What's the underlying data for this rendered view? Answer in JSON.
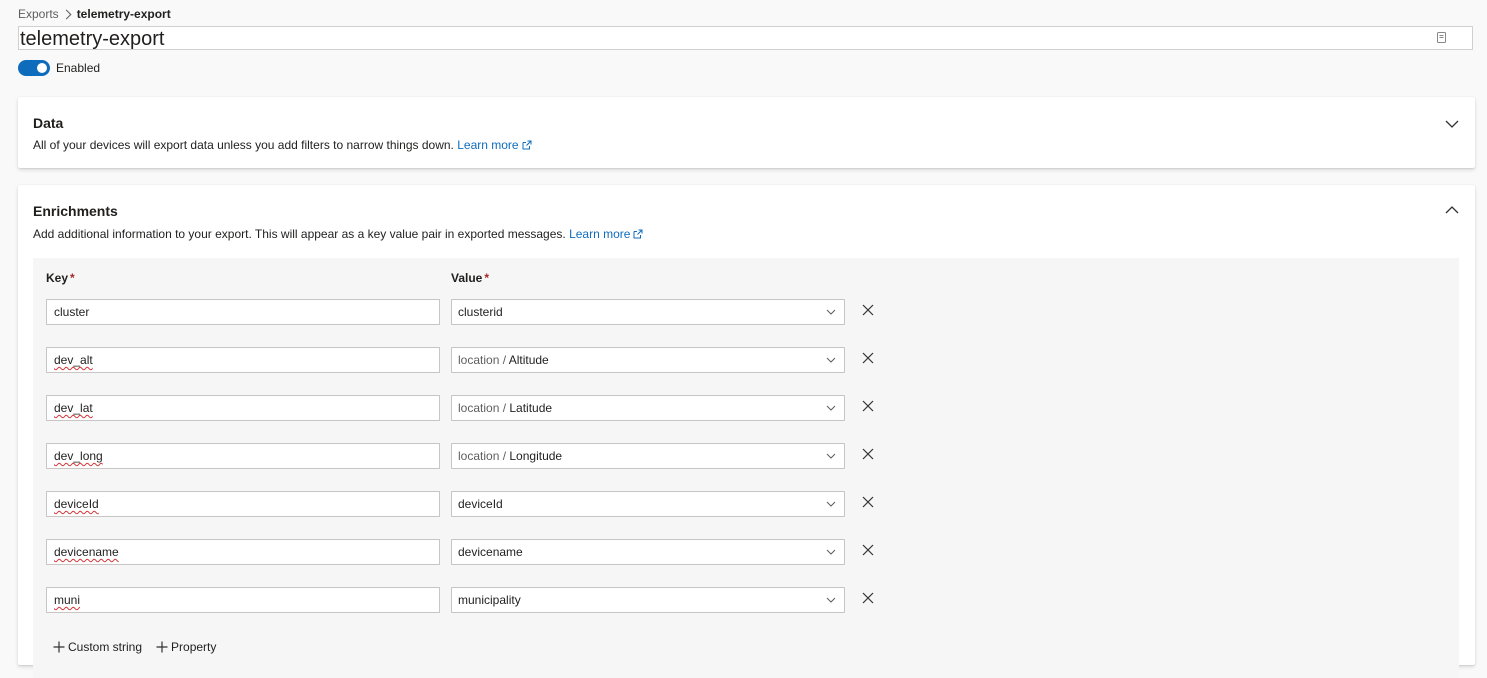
{
  "breadcrumb": {
    "parent": "Exports",
    "current": "telemetry-export"
  },
  "export_name": "telemetry-export",
  "toggle": {
    "label": "Enabled",
    "on": true
  },
  "data_section": {
    "title": "Data",
    "description": "All of your devices will export data unless you add filters to narrow things down.",
    "learn_more": "Learn more",
    "expanded": false
  },
  "enrichments_section": {
    "title": "Enrichments",
    "description": "Add additional information to your export. This will appear as a key value pair in exported messages.",
    "learn_more": "Learn more",
    "expanded": true,
    "key_header": "Key",
    "value_header": "Value",
    "required_marker": "*",
    "rows": [
      {
        "key": "cluster",
        "value_prefix": "",
        "value": "clusterid"
      },
      {
        "key": "dev_alt",
        "value_prefix": "location / ",
        "value": "Altitude"
      },
      {
        "key": "dev_lat",
        "value_prefix": "location / ",
        "value": "Latitude"
      },
      {
        "key": "dev_long",
        "value_prefix": "location / ",
        "value": "Longitude"
      },
      {
        "key": "deviceId",
        "value_prefix": "",
        "value": "deviceId"
      },
      {
        "key": "devicename",
        "value_prefix": "",
        "value": "devicename"
      },
      {
        "key": "muni",
        "value_prefix": "",
        "value": "municipality"
      }
    ],
    "add_custom_string": "Custom string",
    "add_property": "Property"
  },
  "colors": {
    "accent": "#0f6cbd",
    "required": "#a4262c",
    "background": "#f9f9f9"
  }
}
